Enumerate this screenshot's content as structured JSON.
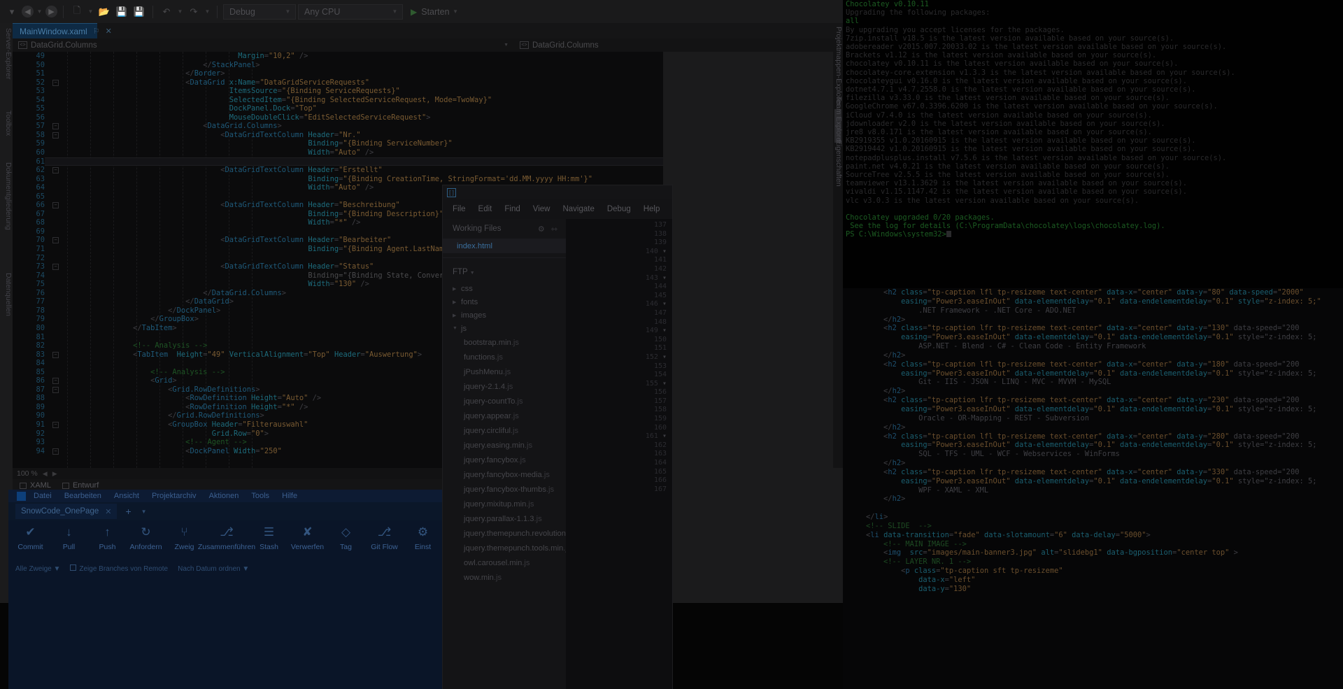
{
  "vs": {
    "toolbar": {
      "config": "Debug",
      "platform": "Any CPU",
      "run": "Starten",
      "back_icon": "back-arrow-icon",
      "forward_icon": "forward-arrow-icon",
      "new_icon": "new-item-icon",
      "open_icon": "open-folder-icon",
      "save_icon": "save-icon",
      "saveall_icon": "save-all-icon",
      "undo_icon": "undo-icon",
      "redo_icon": "redo-icon"
    },
    "tab": {
      "title": "MainWindow.xaml",
      "pin": "⚐",
      "close": "✕"
    },
    "navbar": {
      "left": "DataGrid.Columns",
      "right": "DataGrid.Columns"
    },
    "status": {
      "zoom": "100 %"
    },
    "designer_tabs": [
      "XAML",
      "Entwurf"
    ],
    "left_docks": [
      "Server-Explorer",
      "Toolbox",
      "Dokumentgliederung",
      "Datenquellen"
    ],
    "right_docks": [
      "Projektmappen-Explorer",
      "Team Explorer",
      "Eigenschaften"
    ],
    "code": [
      {
        "n": 49,
        "fold": "",
        "text": "                                        Margin=\"10,2\" />"
      },
      {
        "n": 50,
        "fold": "",
        "text": "                                </StackPanel>"
      },
      {
        "n": 51,
        "fold": "",
        "text": "                            </Border>"
      },
      {
        "n": 52,
        "fold": "-",
        "text": "                            <DataGrid x:Name=\"DataGridServiceRequests\""
      },
      {
        "n": 53,
        "fold": "",
        "text": "                                      ItemsSource=\"{Binding ServiceRequests}\""
      },
      {
        "n": 54,
        "fold": "",
        "text": "                                      SelectedItem=\"{Binding SelectedServiceRequest, Mode=TwoWay}\""
      },
      {
        "n": 55,
        "fold": "",
        "text": "                                      DockPanel.Dock=\"Top\""
      },
      {
        "n": 56,
        "fold": "",
        "text": "                                      MouseDoubleClick=\"EditSelectedServiceRequest\">"
      },
      {
        "n": 57,
        "fold": "-",
        "text": "                                <DataGrid.Columns>"
      },
      {
        "n": 58,
        "fold": "-",
        "text": "                                    <DataGridTextColumn Header=\"Nr.\""
      },
      {
        "n": 59,
        "fold": "",
        "text": "                                                        Binding=\"{Binding ServiceNumber}\""
      },
      {
        "n": 60,
        "fold": "",
        "text": "                                                        Width=\"Auto\" />"
      },
      {
        "n": 61,
        "fold": "",
        "text": ""
      },
      {
        "n": 62,
        "fold": "-",
        "text": "                                    <DataGridTextColumn Header=\"Erstellt\""
      },
      {
        "n": 63,
        "fold": "",
        "text": "                                                        Binding=\"{Binding CreationTime, StringFormat='dd.MM.yyyy HH:mm'}\""
      },
      {
        "n": 64,
        "fold": "",
        "text": "                                                        Width=\"Auto\" />"
      },
      {
        "n": 65,
        "fold": "",
        "text": ""
      },
      {
        "n": 66,
        "fold": "-",
        "text": "                                    <DataGridTextColumn Header=\"Beschreibung\""
      },
      {
        "n": 67,
        "fold": "",
        "text": "                                                        Binding=\"{Binding Description}\""
      },
      {
        "n": 68,
        "fold": "",
        "text": "                                                        Width=\"*\" />"
      },
      {
        "n": 69,
        "fold": "",
        "text": ""
      },
      {
        "n": 70,
        "fold": "-",
        "text": "                                    <DataGridTextColumn Header=\"Bearbeiter\""
      },
      {
        "n": 71,
        "fold": "",
        "text": "                                                        Binding=\"{Binding Agent.LastName}\" />"
      },
      {
        "n": 72,
        "fold": "",
        "text": ""
      },
      {
        "n": 73,
        "fold": "-",
        "text": "                                    <DataGridTextColumn Header=\"Status\""
      },
      {
        "n": 74,
        "fold": "",
        "text": "                                                        Binding=\"{Binding State, Converter={St"
      },
      {
        "n": 75,
        "fold": "",
        "text": "                                                        Width=\"130\" />"
      },
      {
        "n": 76,
        "fold": "",
        "text": "                                </DataGrid.Columns>"
      },
      {
        "n": 77,
        "fold": "",
        "text": "                            </DataGrid>"
      },
      {
        "n": 78,
        "fold": "",
        "text": "                        </DockPanel>"
      },
      {
        "n": 79,
        "fold": "",
        "text": "                    </GroupBox>"
      },
      {
        "n": 80,
        "fold": "",
        "text": "                </TabItem>"
      },
      {
        "n": 81,
        "fold": "",
        "text": ""
      },
      {
        "n": 82,
        "fold": "",
        "text": "                <!-- Analysis -->"
      },
      {
        "n": 83,
        "fold": "-",
        "text": "                <TabItem  Height=\"49\" VerticalAlignment=\"Top\" Header=\"Auswertung\">"
      },
      {
        "n": 84,
        "fold": "",
        "text": ""
      },
      {
        "n": 85,
        "fold": "",
        "text": "                    <!-- Analysis -->"
      },
      {
        "n": 86,
        "fold": "-",
        "text": "                    <Grid>"
      },
      {
        "n": 87,
        "fold": "-",
        "text": "                        <Grid.RowDefinitions>"
      },
      {
        "n": 88,
        "fold": "",
        "text": "                            <RowDefinition Height=\"Auto\" />"
      },
      {
        "n": 89,
        "fold": "",
        "text": "                            <RowDefinition Height=\"*\" />"
      },
      {
        "n": 90,
        "fold": "",
        "text": "                        </Grid.RowDefinitions>"
      },
      {
        "n": 91,
        "fold": "-",
        "text": "                        <GroupBox Header=\"Filterauswahl\""
      },
      {
        "n": 92,
        "fold": "",
        "text": "                                  Grid.Row=\"0\">"
      },
      {
        "n": 93,
        "fold": "",
        "text": "                            <!-- Agent -->"
      },
      {
        "n": 94,
        "fold": "-",
        "text": "                            <DockPanel Width=\"250\""
      }
    ]
  },
  "brackets": {
    "menu": [
      "File",
      "Edit",
      "Find",
      "View",
      "Navigate",
      "Debug",
      "Help"
    ],
    "working_files_label": "Working Files",
    "gear_icon": "gear-icon",
    "split_icon": "split-view-icon",
    "open_file": "index.html",
    "ftp_label": "FTP",
    "tree": [
      {
        "name": "css",
        "type": "folder",
        "open": false
      },
      {
        "name": "fonts",
        "type": "folder",
        "open": false
      },
      {
        "name": "images",
        "type": "folder",
        "open": false
      },
      {
        "name": "js",
        "type": "folder",
        "open": true
      }
    ],
    "js_files": [
      "bootstrap.min.js",
      "functions.js",
      "jPushMenu.js",
      "jquery-2.1.4.js",
      "jquery-countTo.js",
      "jquery.appear.js",
      "jquery.circliful.js",
      "jquery.easing.min.js",
      "jquery.fancybox.js",
      "jquery.fancybox-media.js",
      "jquery.fancybox-thumbs.js",
      "jquery.mixitup.min.js",
      "jquery.parallax-1.1.3.js",
      "jquery.themepunch.revolution.min.js",
      "jquery.themepunch.tools.min.js",
      "owl.carousel.min.js",
      "wow.min.js"
    ],
    "line_numbers": [
      "137",
      "138",
      "139",
      "140 ▾",
      "141",
      "142",
      "143 ▾",
      "144",
      "145",
      "146 ▾",
      "147",
      "148",
      "149 ▾",
      "150",
      "151",
      "152 ▾",
      "153",
      "154",
      "155 ▾",
      "156",
      "157",
      "158",
      "159",
      "160",
      "161 ▾",
      "162",
      "163",
      "164",
      "165",
      "166",
      "167"
    ]
  },
  "powershell": {
    "lines": [
      {
        "t": "Chocolatey v0.10.11",
        "c": "g"
      },
      {
        "t": "Upgrading the following packages:",
        "c": "n"
      },
      {
        "t": "all",
        "c": "g"
      },
      {
        "t": "By upgrading you accept licenses for the packages.",
        "c": "n"
      },
      {
        "t": "7zip.install v18.5 is the latest version available based on your source(s).",
        "c": "n"
      },
      {
        "t": "adobereader v2015.007.20033.02 is the latest version available based on your source(s).",
        "c": "n"
      },
      {
        "t": "Brackets v1.12 is the latest version available based on your source(s).",
        "c": "n"
      },
      {
        "t": "chocolatey v0.10.11 is the latest version available based on your source(s).",
        "c": "n"
      },
      {
        "t": "chocolatey-core.extension v1.3.3 is the latest version available based on your source(s).",
        "c": "n"
      },
      {
        "t": "chocolateygui v0.16.0 is the latest version available based on your source(s).",
        "c": "n"
      },
      {
        "t": "dotnet4.7.1 v4.7.2558.0 is the latest version available based on your source(s).",
        "c": "n"
      },
      {
        "t": "filezilla v3.33.0 is the latest version available based on your source(s).",
        "c": "n"
      },
      {
        "t": "GoogleChrome v67.0.3396.6200 is the latest version available based on your source(s).",
        "c": "n"
      },
      {
        "t": "iCloud v7.4.0 is the latest version available based on your source(s).",
        "c": "n"
      },
      {
        "t": "jdownloader v2.0 is the latest version available based on your source(s).",
        "c": "n"
      },
      {
        "t": "jre8 v8.0.171 is the latest version available based on your source(s).",
        "c": "n"
      },
      {
        "t": "KB2919355 v1.0.20160915 is the latest version available based on your source(s).",
        "c": "n"
      },
      {
        "t": "KB2919442 v1.0.20160915 is the latest version available based on your source(s).",
        "c": "n"
      },
      {
        "t": "notepadplusplus.install v7.5.6 is the latest version available based on your source(s).",
        "c": "n"
      },
      {
        "t": "paint.net v4.0.21 is the latest version available based on your source(s).",
        "c": "n"
      },
      {
        "t": "SourceTree v2.5.5 is the latest version available based on your source(s).",
        "c": "n"
      },
      {
        "t": "teamviewer v13.1.3629 is the latest version available based on your source(s).",
        "c": "n"
      },
      {
        "t": "vivaldi v1.15.1147.42 is the latest version available based on your source(s).",
        "c": "n"
      },
      {
        "t": "vlc v3.0.3 is the latest version available based on your source(s).",
        "c": "n"
      },
      {
        "t": "",
        "c": "n"
      },
      {
        "t": "Chocolatey upgraded 0/20 packages.",
        "c": "g"
      },
      {
        "t": " See the log for details (C:\\ProgramData\\chocolatey\\logs\\chocolatey.log).",
        "c": "g"
      }
    ],
    "prompt": "PS C:\\Windows\\system32>"
  },
  "html_code": {
    "lines": [
      "        <h2 class=\"tp-caption lfl tp-resizeme text-center\" data-x=\"center\" data-y=\"80\" data-speed=\"2000\"",
      "            easing=\"Power3.easeInOut\" data-elementdelay=\"0.1\" data-endelementdelay=\"0.1\" style=\"z-index: 5;\"",
      "                .NET Framework - .NET Core - ADO.NET",
      "        </h2>",
      "        <h2 class=\"tp-caption lfr tp-resizeme text-center\" data-x=\"center\" data-y=\"130\" data-speed=\"200",
      "            easing=\"Power3.easeInOut\" data-elementdelay=\"0.1\" data-endelementdelay=\"0.1\" style=\"z-index: 5;",
      "                ASP.NET - Blend - C# - Clean Code - Entity Framework",
      "        </h2>",
      "        <h2 class=\"tp-caption lfl tp-resizeme text-center\" data-x=\"center\" data-y=\"180\" data-speed=\"200",
      "            easing=\"Power3.easeInOut\" data-elementdelay=\"0.1\" data-endelementdelay=\"0.1\" style=\"z-index: 5;",
      "                Git - IIS - JSON - LINQ - MVC - MVVM - MySQL",
      "        </h2>",
      "        <h2 class=\"tp-caption lfr tp-resizeme text-center\" data-x=\"center\" data-y=\"230\" data-speed=\"200",
      "            easing=\"Power3.easeInOut\" data-elementdelay=\"0.1\" data-endelementdelay=\"0.1\" style=\"z-index: 5;",
      "                Oracle - OR-Mapping - REST - Subversion",
      "        </h2>",
      "        <h2 class=\"tp-caption lfl tp-resizeme text-center\" data-x=\"center\" data-y=\"280\" data-speed=\"200",
      "            easing=\"Power3.easeInOut\" data-elementdelay=\"0.1\" data-endelementdelay=\"0.1\" style=\"z-index: 5;",
      "                SQL - TFS - UML - WCF - Webservices - WinForms",
      "        </h2>",
      "        <h2 class=\"tp-caption lfr tp-resizeme text-center\" data-x=\"center\" data-y=\"330\" data-speed=\"200",
      "            easing=\"Power3.easeInOut\" data-elementdelay=\"0.1\" data-endelementdelay=\"0.1\" style=\"z-index: 5;",
      "                WPF - XAML - XML",
      "        </h2>",
      "",
      "    </li>",
      "    <!-- SLIDE  -->",
      "    <li data-transition=\"fade\" data-slotamount=\"6\" data-delay=\"5000\">",
      "        <!-- MAIN IMAGE -->",
      "        <img  src=\"images/main-banner3.jpg\" alt=\"slidebg1\" data-bgposition=\"center top\" >",
      "        <!-- LAYER NR. 1 -->",
      "            <p class=\"tp-caption sft tp-resizeme\"",
      "                data-x=\"left\"",
      "                data-y=\"130\""
    ]
  },
  "sourcetree": {
    "menu": [
      "Datei",
      "Bearbeiten",
      "Ansicht",
      "Projektarchiv",
      "Aktionen",
      "Tools",
      "Hilfe"
    ],
    "tab": "SnowCode_OnePage",
    "tab_close": "✕",
    "new_tab": "+",
    "buttons": [
      {
        "label": "Commit",
        "icon": "✔"
      },
      {
        "label": "Pull",
        "icon": "↓"
      },
      {
        "label": "Push",
        "icon": "↑"
      },
      {
        "label": "Anfordern",
        "icon": "↻"
      },
      {
        "label": "Zweig",
        "icon": "⑂"
      },
      {
        "label": "Zusammenführen",
        "icon": "⎇"
      },
      {
        "label": "Stash",
        "icon": "☰"
      },
      {
        "label": "Verwerfen",
        "icon": "✘"
      },
      {
        "label": "Tag",
        "icon": "◇"
      },
      {
        "label": "Git Flow",
        "icon": "⎇"
      },
      {
        "label": "Einst",
        "icon": "⚙"
      }
    ],
    "filters": [
      {
        "label": "Alle Zweige",
        "type": "select"
      },
      {
        "label": "Zeige Branches von Remote",
        "type": "checkbox"
      },
      {
        "label": "Nach Datum ordnen",
        "type": "select"
      }
    ]
  }
}
